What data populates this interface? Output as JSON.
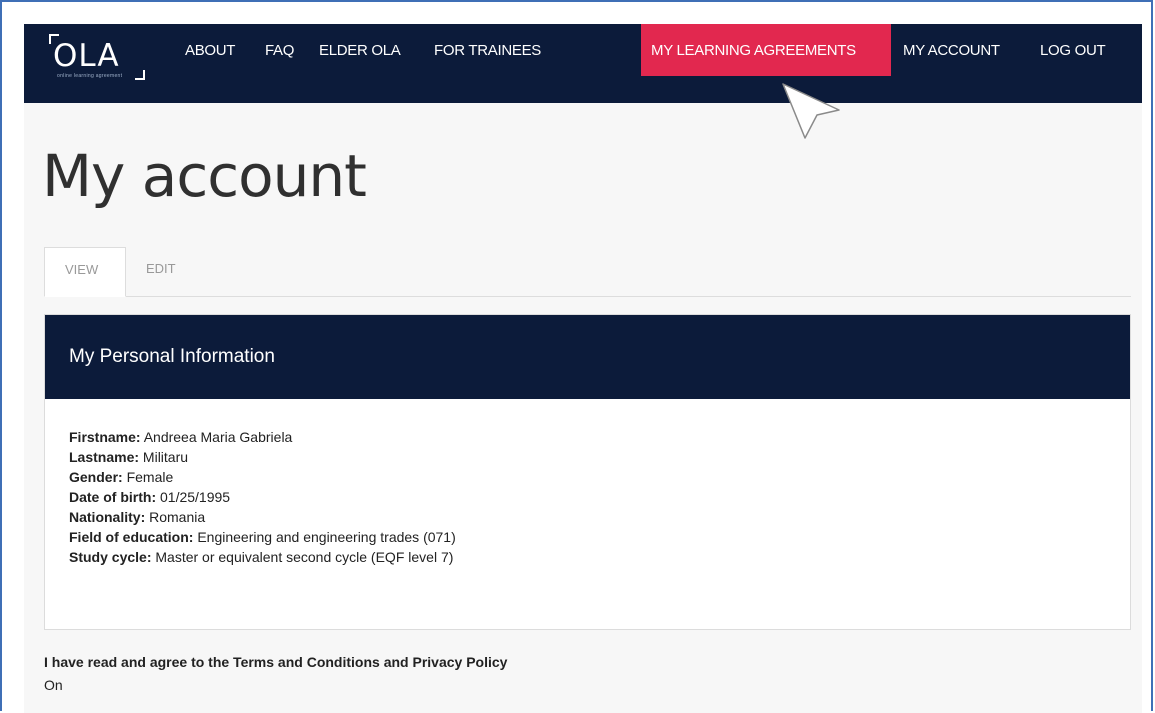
{
  "brand": {
    "logo": "OLA",
    "tagline": "online learning agreement"
  },
  "nav": {
    "about": "ABOUT",
    "faq": "FAQ",
    "elder": "ELDER OLA",
    "trainees": "FOR TRAINEES",
    "agreements": "MY LEARNING AGREEMENTS",
    "account": "MY ACCOUNT",
    "logout": "LOG OUT"
  },
  "page": {
    "title": "My account"
  },
  "tabs": {
    "view": "VIEW",
    "edit": "EDIT"
  },
  "panel": {
    "title": "My Personal Information",
    "fields": [
      {
        "label": "Firstname:",
        "value": "Andreea Maria Gabriela"
      },
      {
        "label": "Lastname:",
        "value": "Militaru"
      },
      {
        "label": "Gender:",
        "value": "Female"
      },
      {
        "label": "Date of birth:",
        "value": "01/25/1995"
      },
      {
        "label": "Nationality:",
        "value": "Romania"
      },
      {
        "label": "Field of education:",
        "value": "Engineering and engineering trades (071)"
      },
      {
        "label": "Study cycle:",
        "value": "Master or equivalent second cycle (EQF level 7)"
      }
    ]
  },
  "terms": {
    "label": "I have read and agree to the Terms and Conditions and Privacy Policy",
    "value": "On"
  },
  "colors": {
    "navy": "#0c1b3a",
    "accent": "#e2284f"
  }
}
